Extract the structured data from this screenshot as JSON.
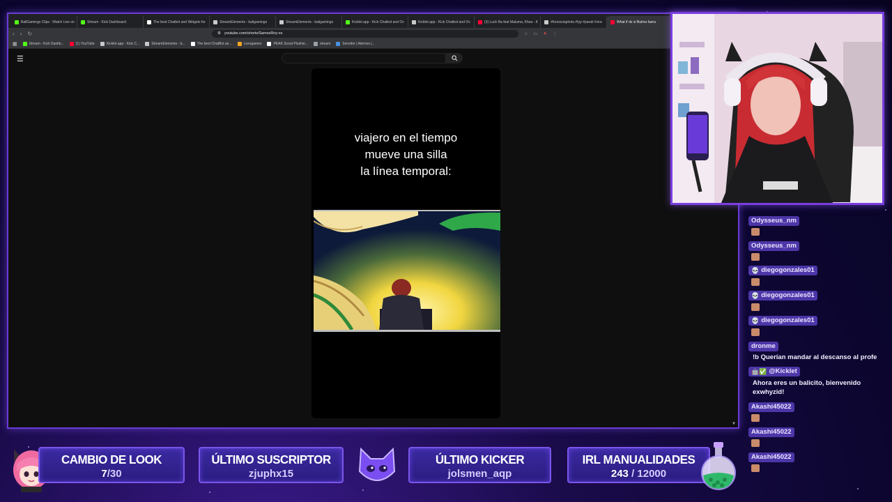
{
  "browser": {
    "tabs": [
      {
        "label": "BallGamings Clips - Watch Live on",
        "color": "#53fc18"
      },
      {
        "label": "Stream - Kick Dashboard",
        "color": "#53fc18"
      },
      {
        "label": "The best Chatbot and Widgets for",
        "color": "#ffffff"
      },
      {
        "label": "StreamElements - baligamings",
        "color": "#c9c9c9"
      },
      {
        "label": "StreamElements - baligamings",
        "color": "#c9c9c9"
      },
      {
        "label": "Kicklet.app - Kick Chatbot and Ov",
        "color": "#53fc18"
      },
      {
        "label": "Kicklet.app - Kick Chatbot and Ov",
        "color": "#c9c9c9"
      },
      {
        "label": "(3) Luck Ra feat Maluma, Khea - K",
        "color": "#ff0033"
      },
      {
        "label": "#fooooziaphola #fyp #parati #vira",
        "color": "#c9c9c9"
      },
      {
        "label": "What if de si Bulma fuera",
        "color": "#ff0033"
      }
    ],
    "url": "youtube.com/shorts/SamsxRny-xs",
    "bookmarks": [
      {
        "label": "Stream - Kick Dashb...",
        "color": "#53fc18"
      },
      {
        "label": "(1) YouTube",
        "color": "#ff0033"
      },
      {
        "label": "Kicklet.app - Kick C...",
        "color": "#c9c9c9"
      },
      {
        "label": "StreamElements - b...",
        "color": "#c9c9c9"
      },
      {
        "label": "The best ChatBot an...",
        "color": "#ffffff"
      },
      {
        "label": "Lexogames",
        "color": "#f5a623"
      },
      {
        "label": "PEAK Scout Plushie...",
        "color": "#ffffff"
      },
      {
        "label": "stream",
        "color": "#9aa0a6"
      },
      {
        "label": "Servidor | Aternos |...",
        "color": "#4a90e2"
      }
    ]
  },
  "short": {
    "caption": [
      "viajero en el tiempo",
      "mueve una silla",
      "la línea temporal:"
    ]
  },
  "chat": [
    {
      "user": "Odysseus_nm",
      "icons": "",
      "emote": true,
      "text": ""
    },
    {
      "user": "Odysseus_nm",
      "icons": "",
      "emote": true,
      "text": ""
    },
    {
      "user": "diegogonzales01",
      "icons": "💀",
      "emote": true,
      "text": ""
    },
    {
      "user": "diegogonzales01",
      "icons": "💀",
      "emote": true,
      "text": ""
    },
    {
      "user": "diegogonzales01",
      "icons": "💀",
      "emote": true,
      "text": ""
    },
    {
      "user": "dronme",
      "icons": "",
      "emote": false,
      "text": "!b Querían mandar al descanso al profe"
    },
    {
      "user": "@Kicklet",
      "icons": "🤖✅",
      "emote": false,
      "text": "Ahora eres un balicito, bienvenido exwhyzid!"
    },
    {
      "user": "Akashi45022",
      "icons": "",
      "emote": true,
      "text": ""
    },
    {
      "user": "Akashi45022",
      "icons": "",
      "emote": true,
      "text": ""
    },
    {
      "user": "Akashi45022",
      "icons": "",
      "emote": true,
      "text": ""
    }
  ],
  "widgets": {
    "look": {
      "title": "CAMBIO DE LOOK",
      "current": "7",
      "goal": "/30"
    },
    "sub": {
      "title": "ÚLTIMO SUSCRIPTOR",
      "value": "zjuphx15"
    },
    "kicker": {
      "title": "ÚLTIMO KICKER",
      "value": "jolsmen_aqp"
    },
    "irl": {
      "title": "IRL MANUALIDADES",
      "current": "243",
      "goal": " / 12000"
    }
  },
  "colors": {
    "accent": "#7b55ea",
    "frame": "#6a3cd6",
    "kick_green": "#53fc18"
  }
}
